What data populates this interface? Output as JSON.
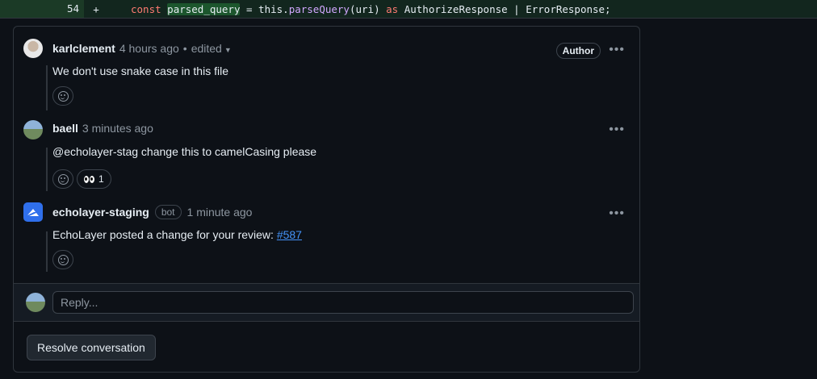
{
  "code_line": {
    "line_number": "54",
    "sign": "+",
    "tokens": {
      "kw_const": "const",
      "var": "parsed_query",
      "eq": " = this.",
      "fn": "parseQuery",
      "args": "(uri) ",
      "kw_as": "as",
      "rest": " AuthorizeResponse | ErrorResponse;"
    }
  },
  "comments": [
    {
      "author": "karlclement",
      "time": "4 hours ago",
      "separator": "•",
      "edited": "edited",
      "badge": "Author",
      "body": "We don't use snake case in this file"
    },
    {
      "author": "baell",
      "time": "3 minutes ago",
      "body": "@echolayer-stag change this to camelCasing please",
      "reaction_count": "1"
    },
    {
      "author": "echolayer-staging",
      "bot_label": "bot",
      "time": "1 minute ago",
      "body_prefix": "EchoLayer posted a change for your review: ",
      "link": "#587"
    }
  ],
  "reply": {
    "placeholder": "Reply..."
  },
  "resolve_label": "Resolve conversation",
  "icons": {
    "more": "kebab-horizontal-icon",
    "reaction": "smiley-icon",
    "eyes": "eyes-emoji-icon"
  },
  "colors": {
    "background": "#0d1117",
    "link": "#4493f8",
    "added_line": "#12261e",
    "border": "#30363d"
  }
}
